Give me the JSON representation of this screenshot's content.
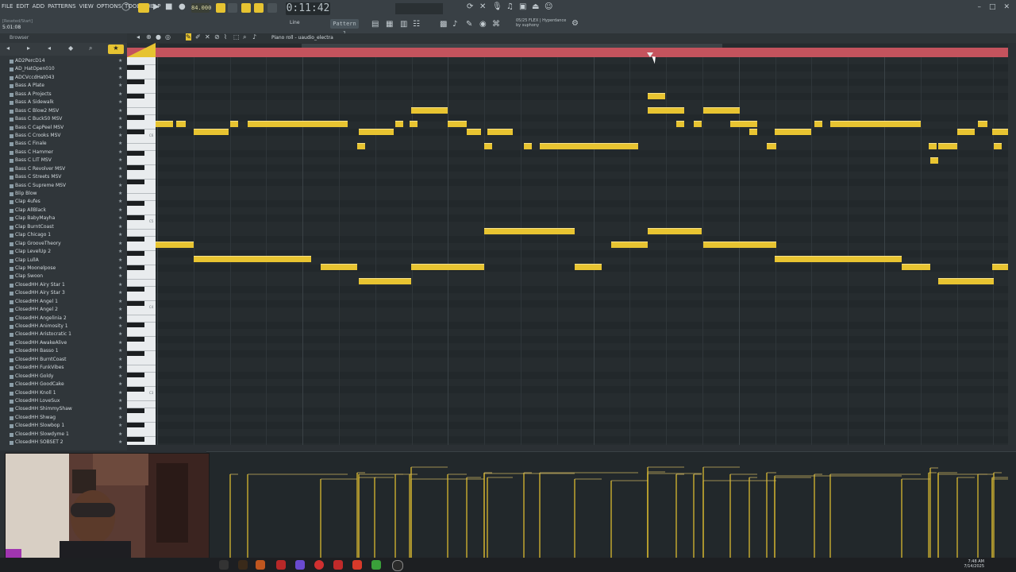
{
  "menu": [
    "FILE",
    "EDIT",
    "ADD",
    "PATTERNS",
    "VIEW",
    "OPTIONS",
    "TOOLS",
    "HELP"
  ],
  "hint_text": "5:01:08",
  "hint_small": "[Reseted/Start]",
  "tempo": "84.000",
  "time_display": "0:11:42",
  "snap_label": "Line",
  "pattern_label": "Pattern 1",
  "plugin_info": [
    "05/25  FLEX | Hyperdance",
    "by suphony"
  ],
  "piano_roll_title": "Piano roll - uaudio_electra",
  "browser_title": "Browser",
  "browser_items": [
    "AD2PercD14",
    "AD_HatOpen010",
    "ADCVccdHat043",
    "Bass A Plate",
    "Bass A Projects",
    "Bass A Sidewalk",
    "Bass C Blow2 MSV",
    "Bass C Buck50 MSV",
    "Bass C CapPeel MSV",
    "Bass C Crooks MSV",
    "Bass C Finale",
    "Bass C Hammer",
    "Bass C LIT MSV",
    "Bass C Revolver MSV",
    "Bass C Streets MSV",
    "Bass C Supreme MSV",
    "Blip Blow",
    "Clap 4ufes",
    "Clap AllBlack",
    "Clap BabyMayha",
    "Clap BurntCoast",
    "Clap Chicago 1",
    "Clap GrooveTheory",
    "Clap LevelUp 2",
    "Clap LullA",
    "Clap Moonelpose",
    "Clap Swoon",
    "ClosedHH Airy Star 1",
    "ClosedHH Airy Star 3",
    "ClosedHH Angel 1",
    "ClosedHH Angel 2",
    "ClosedHH Angelinia 2",
    "ClosedHH Animosity 1",
    "ClosedHH Aristocratic 1",
    "ClosedHH AwakeAlive",
    "ClosedHH Basso 1",
    "ClosedHH BurntCoast",
    "ClosedHH FunkVibes",
    "ClosedHH Goldy",
    "ClosedHH GoodCake",
    "ClosedHH Knoll 1",
    "ClosedHH LoveSux",
    "ClosedHH ShimmyShaw",
    "ClosedHH Shwag",
    "ClosedHH Slowbop 1",
    "ClosedHH Slowdyme 1",
    "ClosedHH SOBSET 2"
  ],
  "key_labels": [
    "C6",
    "C5",
    "C4",
    "C3",
    "C2"
  ],
  "clock": {
    "time": "7:48 AM",
    "date": "7/14/2025"
  },
  "colors": {
    "note": "#e8c431",
    "ruler": "#c4535d",
    "grid": "#262c2f"
  }
}
